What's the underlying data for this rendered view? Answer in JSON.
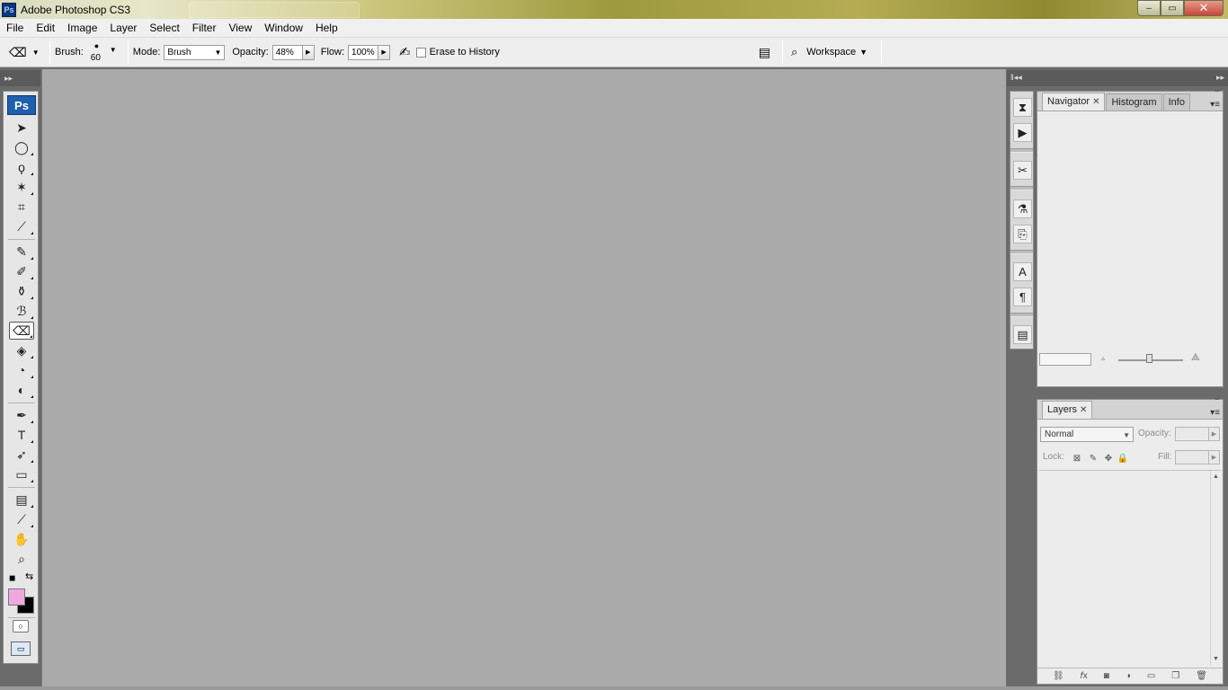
{
  "window": {
    "title": "Adobe Photoshop CS3",
    "app_icon": "Ps",
    "controls": {
      "minimize": "–",
      "maximize": "▭",
      "close": "✕"
    }
  },
  "menu": [
    "File",
    "Edit",
    "Image",
    "Layer",
    "Select",
    "Filter",
    "View",
    "Window",
    "Help"
  ],
  "options": {
    "brush_label": "Brush:",
    "brush_size": "60",
    "mode_label": "Mode:",
    "mode_value": "Brush",
    "opacity_label": "Opacity:",
    "opacity_value": "48%",
    "flow_label": "Flow:",
    "flow_value": "100%",
    "erase_history_label": "Erase to History",
    "workspace_label": "Workspace"
  },
  "toolbox": {
    "badge": "Ps",
    "tools": [
      {
        "name": "move-tool",
        "glyph": "➤"
      },
      {
        "name": "elliptical-marquee-tool",
        "glyph": "◯"
      },
      {
        "name": "lasso-tool",
        "glyph": "ϙ"
      },
      {
        "name": "magic-wand-tool",
        "glyph": "✶"
      },
      {
        "name": "crop-tool",
        "glyph": "⌗"
      },
      {
        "name": "slice-tool",
        "glyph": "⟋"
      },
      {
        "name": "healing-brush-tool",
        "glyph": "✎"
      },
      {
        "name": "brush-tool",
        "glyph": "✐"
      },
      {
        "name": "clone-stamp-tool",
        "glyph": "⚱"
      },
      {
        "name": "history-brush-tool",
        "glyph": "ℬ"
      },
      {
        "name": "eraser-tool",
        "glyph": "⌫",
        "active": true
      },
      {
        "name": "paint-bucket-tool",
        "glyph": "◈"
      },
      {
        "name": "blur-tool",
        "glyph": "◔"
      },
      {
        "name": "dodge-tool",
        "glyph": "◐"
      },
      {
        "name": "pen-tool",
        "glyph": "✒"
      },
      {
        "name": "type-tool",
        "glyph": "T"
      },
      {
        "name": "path-selection-tool",
        "glyph": "➶"
      },
      {
        "name": "rectangle-tool",
        "glyph": "▭"
      },
      {
        "name": "notes-tool",
        "glyph": "▤"
      },
      {
        "name": "eyedropper-tool",
        "glyph": "⟋"
      },
      {
        "name": "hand-tool",
        "glyph": "✋"
      },
      {
        "name": "zoom-tool",
        "glyph": "⌕"
      }
    ],
    "foreground_color": "#f0a9e0",
    "background_color": "#000000"
  },
  "navigator_panel": {
    "tabs": [
      "Navigator",
      "Histogram",
      "Info"
    ],
    "close_glyph": "✕"
  },
  "layers_panel": {
    "tab": "Layers",
    "blend_mode": "Normal",
    "opacity_label": "Opacity:",
    "lock_label": "Lock:",
    "fill_label": "Fill:"
  },
  "colors": {
    "canvas": "#aaaaaa",
    "panel_bg": "#ececec",
    "workspace_bg": "#6b6b6b"
  }
}
